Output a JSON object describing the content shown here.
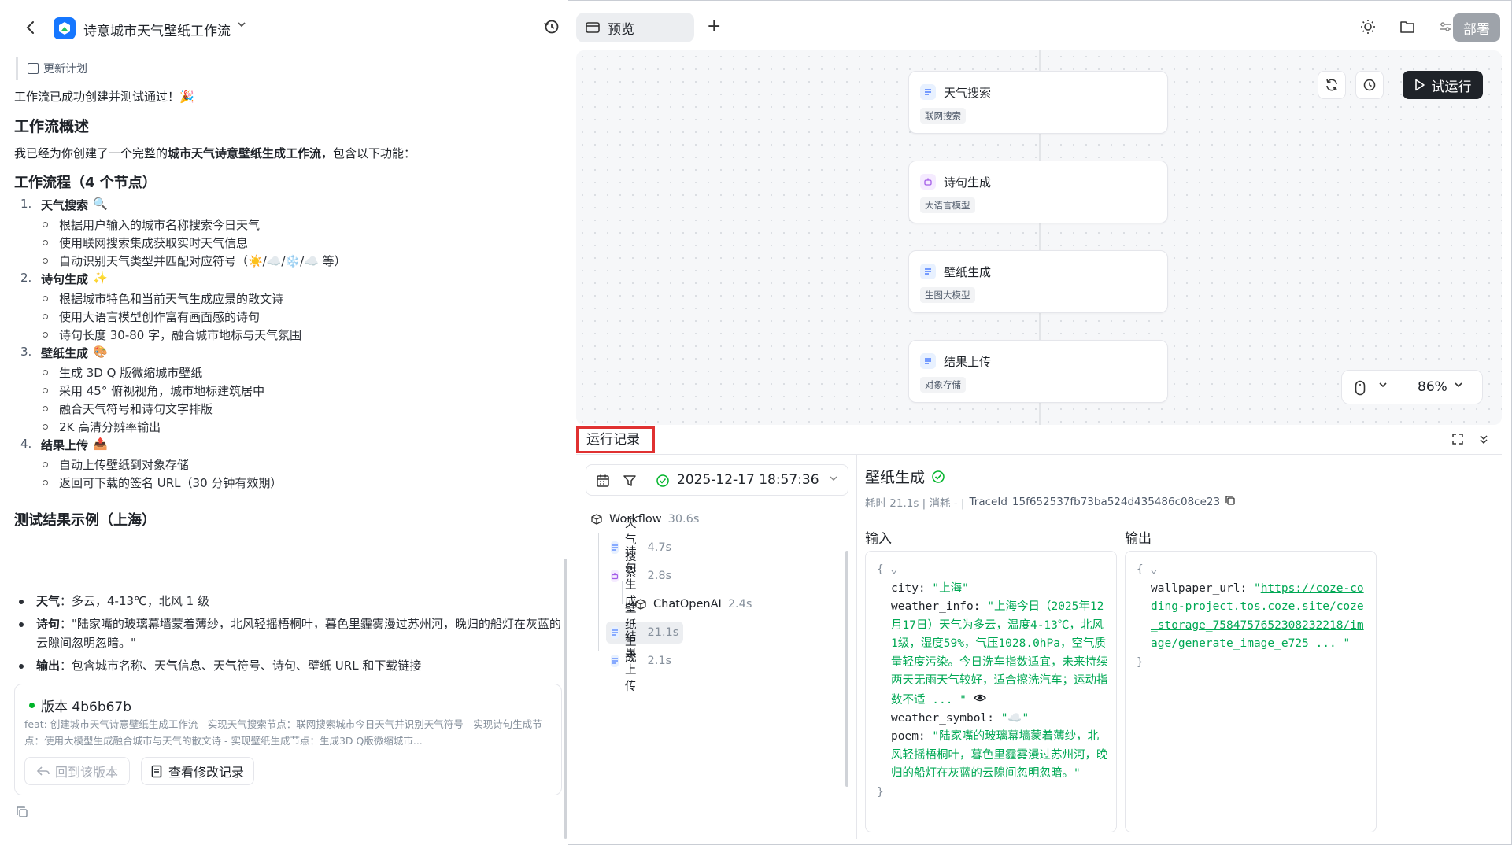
{
  "app": {
    "title": "诗意城市天气壁纸工作流"
  },
  "chat": {
    "plan_link": "更新计划",
    "success": "工作流已成功创建并测试通过！🎉",
    "overview_heading": "工作流概述",
    "intro_prefix": "我已经为你创建了一个完整的",
    "intro_bold": "城市天气诗意壁纸生成工作流",
    "intro_suffix": "，包含以下功能：",
    "flow_heading": "工作流程（4 个节点）",
    "steps": [
      {
        "num": "1.",
        "title": "天气搜索",
        "emoji": "🔍",
        "items": [
          "根据用户输入的城市名称搜索今日天气",
          "使用联网搜索集成获取实时天气信息",
          "自动识别天气类型并匹配对应符号（☀️/☁️/❄️/☁️ 等）"
        ]
      },
      {
        "num": "2.",
        "title": "诗句生成",
        "emoji": "✨",
        "items": [
          "根据城市特色和当前天气生成应景的散文诗",
          "使用大语言模型创作富有画面感的诗句",
          "诗句长度 30-80 字，融合城市地标与天气氛围"
        ]
      },
      {
        "num": "3.",
        "title": "壁纸生成",
        "emoji": "🎨",
        "items": [
          "生成 3D Q 版微缩城市壁纸",
          "采用 45° 俯视视角，城市地标建筑居中",
          "融合天气符号和诗句文字排版",
          "2K 高清分辨率输出"
        ]
      },
      {
        "num": "4.",
        "title": "结果上传",
        "emoji": "📤",
        "items": [
          "自动上传壁纸到对象存储",
          "返回可下载的签名 URL（30 分钟有效期）"
        ]
      }
    ],
    "result_heading": "测试结果示例（上海）",
    "results": [
      {
        "label": "天气",
        "text": "：多云，4-13℃，北风 1 级"
      },
      {
        "label": "诗句",
        "text": "：\"陆家嘴的玻璃幕墙蒙着薄纱，北风轻摇梧桐叶，暮色里霾雾漫过苏州河，晚归的船灯在灰蓝的云隙间忽明忽暗。\""
      },
      {
        "label": "输出",
        "text": "：包含城市名称、天气信息、天气符号、诗句、壁纸 URL 和下载链接"
      }
    ],
    "version": {
      "title": "版本 4b6b67b",
      "desc": "feat: 创建城市天气诗意壁纸生成工作流 - 实现天气搜索节点：联网搜索城市今日天气并识别天气符号 - 实现诗句生成节点：使用大模型生成融合城市与天气的散文诗 - 实现壁纸生成节点：生成3D Q版微缩城市...",
      "revert_label": "回到该版本",
      "changes_label": "查看修改记录"
    }
  },
  "header": {
    "preview_tab": "预览",
    "add_tab": "+",
    "deploy_label": "部署"
  },
  "canvas": {
    "trial_run": "试运行",
    "zoom": "86%",
    "nodes": [
      {
        "title": "天气搜索",
        "tag": "联网搜索",
        "kind": "search"
      },
      {
        "title": "诗句生成",
        "tag": "大语言模型",
        "kind": "llm"
      },
      {
        "title": "壁纸生成",
        "tag": "生图大模型",
        "kind": "image"
      },
      {
        "title": "结果上传",
        "tag": "对象存储",
        "kind": "storage"
      }
    ]
  },
  "runlog": {
    "title": "运行记录",
    "run_time": "2025-12-17 18:57:36",
    "tree": [
      {
        "label": "Workflow",
        "dur": "30.6s"
      },
      {
        "label": "天气搜索",
        "dur": "4.7s"
      },
      {
        "label": "诗句生成",
        "dur": "2.8s"
      },
      {
        "label": "ChatOpenAI",
        "dur": "2.4s"
      },
      {
        "label": "壁纸生成",
        "dur": "21.1s"
      },
      {
        "label": "结果上传",
        "dur": "2.1s"
      }
    ],
    "detail": {
      "title": "壁纸生成",
      "meta_prefix": "耗时 21.1s | 消耗 - |",
      "trace_label": "TraceId",
      "trace_id": "15f652537fb73ba524d435486c08ce23",
      "input_label": "输入",
      "output_label": "输出",
      "input": {
        "city_key": "city:",
        "city_val": "\"上海\"",
        "weather_key": "weather_info:",
        "weather_val": "\"上海今日（2025年12月17日）天气为多云，温度4-13℃，北风1级，湿度59%，气压1028.0hPa，空气质量轻度污染。今日洗车指数适宜，未来持续两天无雨天气较好，适合擦洗汽车；运动指数不适 ... \"",
        "symbol_key": "weather_symbol:",
        "symbol_val": "\"☁️\"",
        "poem_key": "poem:",
        "poem_val": "\"陆家嘴的玻璃幕墙蒙着薄纱，北风轻摇梧桐叶，暮色里霾雾漫过苏州河，晚归的船灯在灰蓝的云隙间忽明忽暗。\""
      },
      "output": {
        "url_key": "wallpaper_url:",
        "url_val": "https://coze-coding-project.tos.coze.site/coze_storage_7584757652308232218/image/generate_image_e725",
        "url_tail": "... \""
      }
    }
  },
  "colors": {
    "accent": "#1677ff",
    "success": "#00b42a",
    "json_value": "#00a854",
    "highlight_border": "#e03131"
  }
}
